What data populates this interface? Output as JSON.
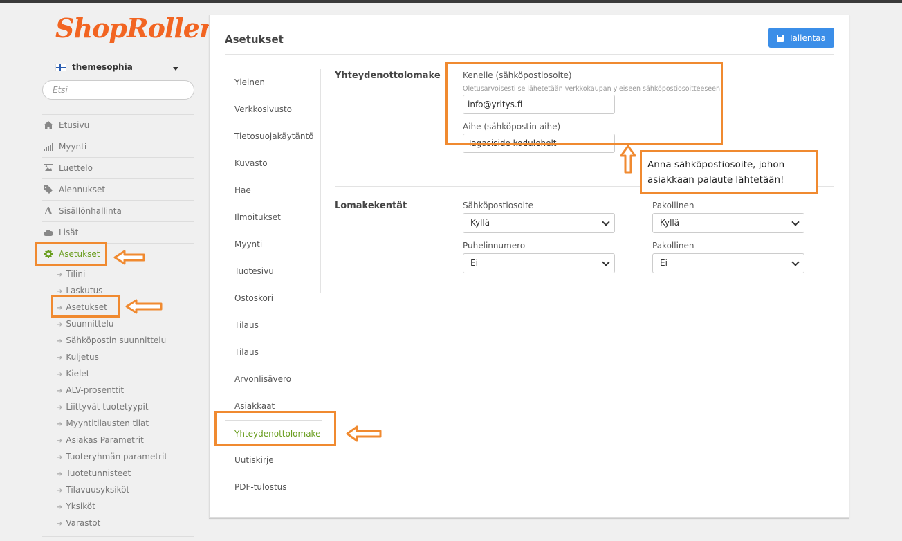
{
  "app": {
    "logo": "ShopRoller"
  },
  "sidebar": {
    "store_name": "themesophia",
    "search_placeholder": "Etsi",
    "nav": [
      {
        "label": "Etusivu",
        "icon": "home-icon"
      },
      {
        "label": "Myynti",
        "icon": "bar-chart-icon"
      },
      {
        "label": "Luettelo",
        "icon": "image-icon"
      },
      {
        "label": "Alennukset",
        "icon": "tags-icon"
      },
      {
        "label": "Sisällönhallinta",
        "icon": "font-icon"
      },
      {
        "label": "Lisät",
        "icon": "cloud-icon"
      },
      {
        "label": "Asetukset",
        "icon": "gear-icon"
      }
    ],
    "subnav": [
      "Tilini",
      "Laskutus",
      "Asetukset",
      "Suunnittelu",
      "Sähköpostin suunnittelu",
      "Kuljetus",
      "Kielet",
      "ALV-prosenttit",
      "Liittyvät tuotetyypit",
      "Myyntitilausten tilat",
      "Asiakas Parametrit",
      "Tuoteryhmän parametrit",
      "Tuotetunnisteet",
      "Tilavuusyksiköt",
      "Yksiköt",
      "Varastot"
    ]
  },
  "main": {
    "title": "Asetukset",
    "save_label": "Tallentaa",
    "tabs": [
      "Yleinen",
      "Verkkosivusto",
      "Tietosuojakäytäntö",
      "Kuvasto",
      "Hae",
      "Ilmoitukset",
      "Myynti",
      "Tuotesivu",
      "Ostoskori",
      "Tilaus",
      "Tilaus",
      "Arvonlisävero",
      "Asiakkaat",
      "Yhteydenottolomake",
      "Uutiskirje",
      "PDF-tulostus"
    ],
    "active_tab": "Yhteydenottolomake",
    "contact_form": {
      "title": "Yhteydenottolomake",
      "to_label": "Kenelle (sähköpostiosoite)",
      "to_hint": "Oletusarvoisesti se lähetetään verkkokaupan yleiseen sähköpostiosoitteeseen.",
      "to_value": "info@yritys.fi",
      "subject_label": "Aihe (sähköpostin aihe)",
      "subject_value": "Tagasiside kodulehelt"
    },
    "form_fields": {
      "title": "Lomakekentät",
      "rows": [
        {
          "label": "Sähköpostiosoite",
          "value": "Kyllä",
          "req_label": "Pakollinen",
          "req_value": "Kyllä"
        },
        {
          "label": "Puhelinnumero",
          "value": "Ei",
          "req_label": "Pakollinen",
          "req_value": "Ei"
        }
      ]
    }
  },
  "annotation": {
    "callout_text": "Anna sähköpostiosoite, johon asiakkaan palaute lähtetään!",
    "color": "#f08a30"
  },
  "colors": {
    "brand": "#f26522",
    "active": "#6a9e1f",
    "primary_button": "#3b8ee8"
  }
}
